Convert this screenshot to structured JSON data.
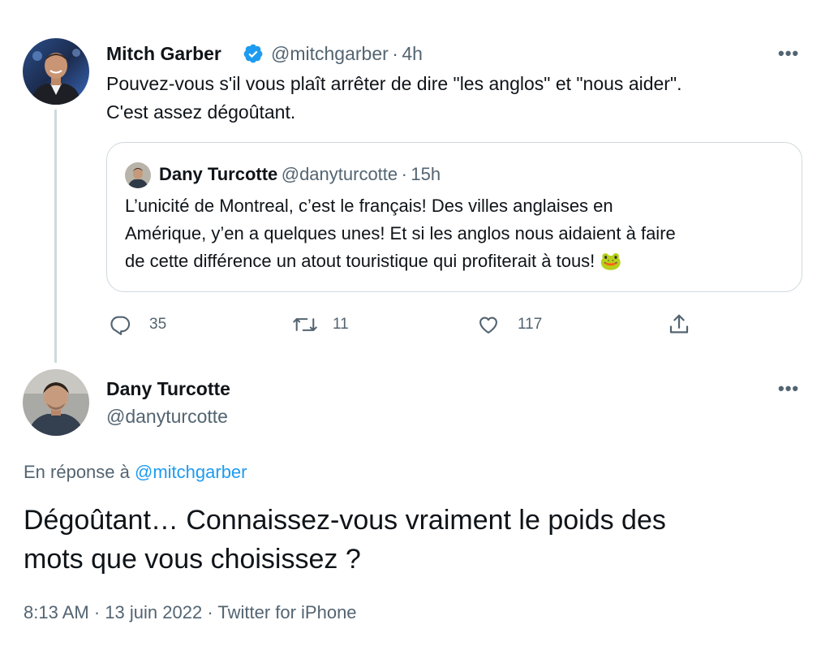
{
  "tweet1": {
    "display_name": "Mitch Garber",
    "handle": "@mitchgarber",
    "separator": "·",
    "time": "4h",
    "verified_icon": "verified-badge-icon",
    "text_line1": "Pouvez-vous s'il vous plaît arrêter de dire \"les anglos\" et \"nous aider\".",
    "text_line2": "C'est assez dégoûtant.",
    "more_label": "•••",
    "quoted": {
      "display_name": "Dany Turcotte",
      "handle": "@danyturcotte",
      "separator": "·",
      "time": "15h",
      "text_line1": "L’unicité de Montreal, c’est le français! Des villes anglaises en",
      "text_line2": "Amérique, y’en a quelques unes! Et si les anglos nous aidaient à faire",
      "text_line3": "de cette différence un atout touristique qui profiterait à tous! ",
      "emoji": "🐸"
    },
    "actions": {
      "replies": "35",
      "retweets": "11",
      "likes": "117"
    }
  },
  "tweet2": {
    "display_name": "Dany Turcotte",
    "handle": "@danyturcotte",
    "more_label": "•••",
    "reply_prefix": "En réponse à",
    "reply_mention": "@mitchgarber",
    "text_line1": "Dégoûtant… Connaissez-vous vraiment le poids des",
    "text_line2": "mots que vous choisissez ?",
    "time": "8:13 AM",
    "separator": "·",
    "date": "13 juin 2022",
    "source": "Twitter for iPhone"
  },
  "colors": {
    "text": "#0f1419",
    "secondary": "#536471",
    "accent": "#1d9bf0",
    "border": "#cfd9de"
  }
}
